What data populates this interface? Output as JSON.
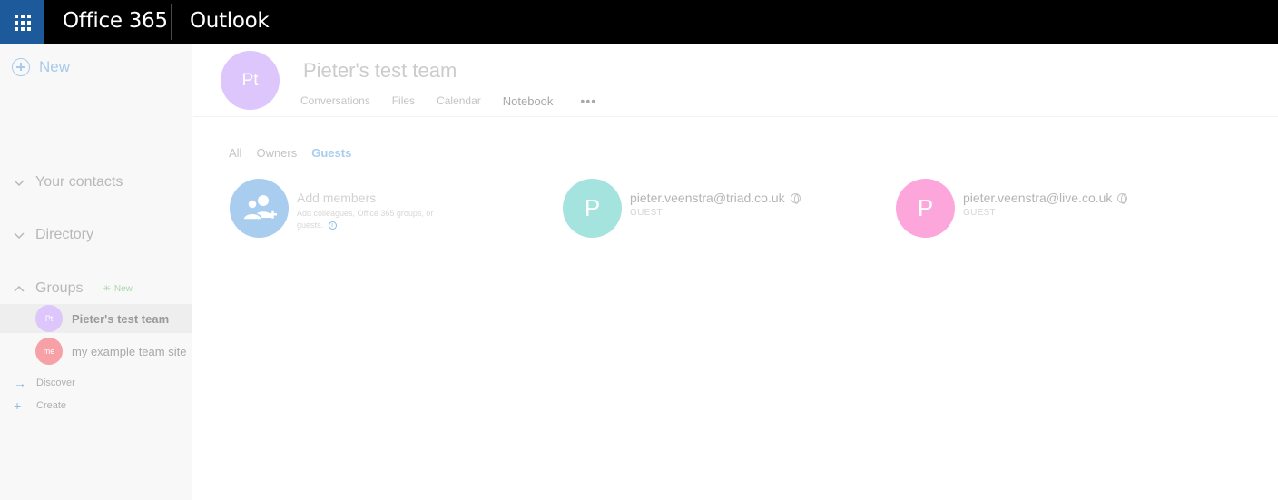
{
  "topbar": {
    "waffle_icon": "app-launcher-icon",
    "brand": "Office 365",
    "app_name": "Outlook",
    "background": "#000000",
    "waffle_bg": "#1c5a9c"
  },
  "sidebar": {
    "new_label": "New",
    "sections": {
      "contacts": "Your contacts",
      "directory": "Directory",
      "groups": "Groups",
      "groups_badge": "New"
    },
    "groups": [
      {
        "initials": "Pt",
        "name": "Pieter's test team",
        "color": "#dcc6fb",
        "selected": true
      },
      {
        "initials": "me",
        "name": "my example team site",
        "color": "#f7a0a5",
        "selected": false
      }
    ],
    "links": {
      "discover": "Discover",
      "create": "Create"
    }
  },
  "team": {
    "initials": "Pt",
    "title": "Pieter's test team",
    "tabs": [
      "Conversations",
      "Files",
      "Calendar",
      "Notebook"
    ],
    "more": "•••"
  },
  "filters": {
    "all": "All",
    "owners": "Owners",
    "guests": "Guests",
    "active": "Guests"
  },
  "add_members": {
    "title": "Add members",
    "description": "Add colleagues, Office 365 groups, or guests.",
    "icon": "add-people-icon",
    "color": "#a9cdee"
  },
  "members": [
    {
      "initial": "P",
      "email": "pieter.veenstra@triad.co.uk",
      "role": "GUEST",
      "color": "#a5e3df"
    },
    {
      "initial": "P",
      "email": "pieter.veenstra@live.co.uk",
      "role": "GUEST",
      "color": "#fca6dc"
    }
  ]
}
